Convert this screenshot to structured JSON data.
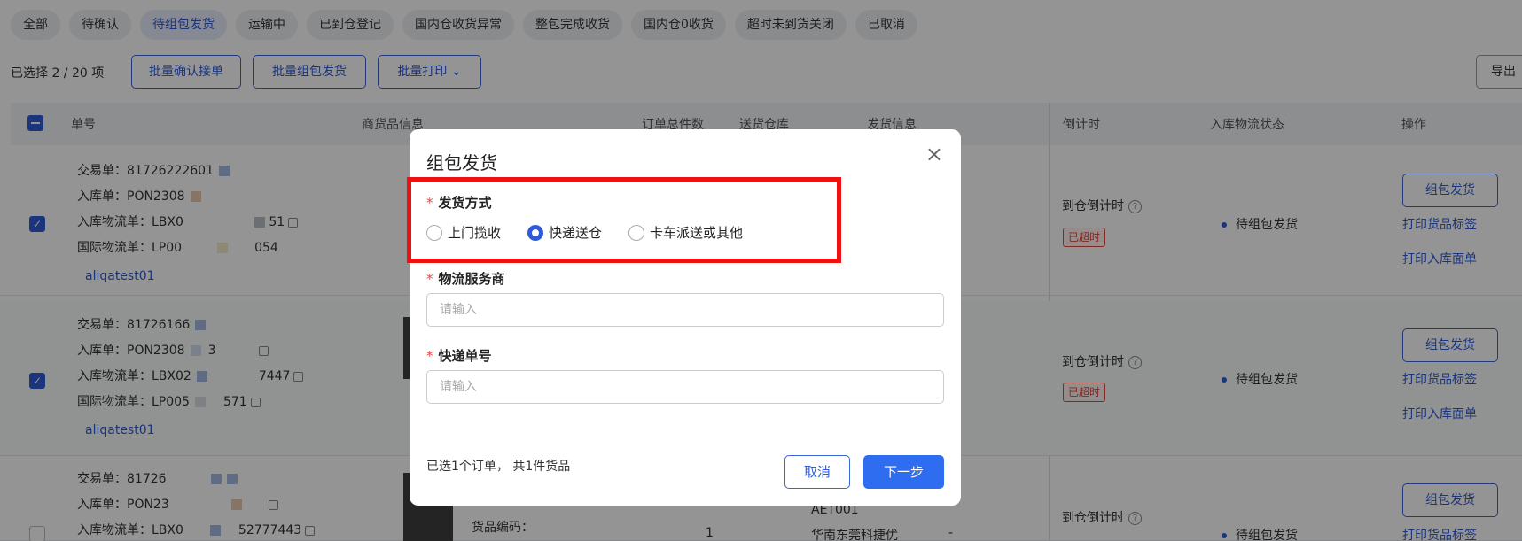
{
  "tabs": [
    "全部",
    "待确认",
    "待组包发货",
    "运输中",
    "已到仓登记",
    "国内仓收货异常",
    "整包完成收货",
    "国内仓0收货",
    "超时未到货关闭",
    "已取消"
  ],
  "active_tab_index": 2,
  "actionbar": {
    "selection": "已选择 2 / 20 项",
    "batch_confirm": "批量确认接单",
    "batch_ship": "批量组包发货",
    "batch_print": "批量打印",
    "export": "导出"
  },
  "table": {
    "headers": {
      "order_no": "单号",
      "goods_info": "商货品信息",
      "total_qty": "订单总件数",
      "warehouse": "送货仓库",
      "ship_info": "发货信息",
      "countdown": "倒计时",
      "inbound_status": "入库物流状态",
      "operation": "操作"
    },
    "rows": [
      {
        "trade": "交易单：81726222601",
        "inbound": "入库单：PON2308",
        "inbound_logistics": "入库物流单：LBX0",
        "inbound_logistics_tail": "51",
        "intl_logistics": "国际物流单：LP00",
        "intl_logistics_tail": "054",
        "buyer": "aliqatest01",
        "countdown_label": "到仓倒计时",
        "overdue": "已超时",
        "status": "待组包发货",
        "op_btn": "组包发货",
        "op_print_label": "打印货品标签",
        "op_print_inbound": "打印入库面单"
      },
      {
        "trade": "交易单：81726166",
        "inbound": "入库单：PON2308",
        "inbound_tail": "3",
        "inbound_logistics": "入库物流单：LBX02",
        "inbound_logistics_tail": "7447",
        "intl_logistics": "国际物流单：LP005",
        "intl_logistics_tail": "571",
        "buyer": "aliqatest01",
        "countdown_label": "到仓倒计时",
        "overdue": "已超时",
        "status": "待组包发货",
        "op_btn": "组包发货",
        "op_print_label": "打印货品标签",
        "op_print_inbound": "打印入库面单"
      },
      {
        "trade": "交易单：81726",
        "inbound": "入库单：PON23",
        "inbound_logistics": "入库物流单：LBX0",
        "inbound_logistics_tail": "52777443",
        "qty": "1",
        "warehouse_code": "AET001",
        "warehouse_name": "华南东莞科捷优",
        "ship_info": "-",
        "goods_code_label": "货品编码：",
        "countdown_label": "到仓倒计时",
        "status": "待组包发货",
        "op_btn": "组包发货",
        "op_print_label": "打印货品标签"
      }
    ]
  },
  "modal": {
    "title": "组包发货",
    "ship_method_label": "发货方式",
    "ship_options": [
      "上门揽收",
      "快递送仓",
      "卡车派送或其他"
    ],
    "ship_selected_index": 1,
    "carrier_label": "物流服务商",
    "carrier_placeholder": "请输入",
    "tracking_label": "快递单号",
    "tracking_placeholder": "请输入",
    "summary": "已选1个订单， 共1件货品",
    "cancel": "取消",
    "next": "下一步"
  },
  "colors": {
    "accent": "#2e5bd9",
    "primary_button": "#2e6cf0",
    "overdue": "#e0473d",
    "highlight": "#ee1111"
  }
}
